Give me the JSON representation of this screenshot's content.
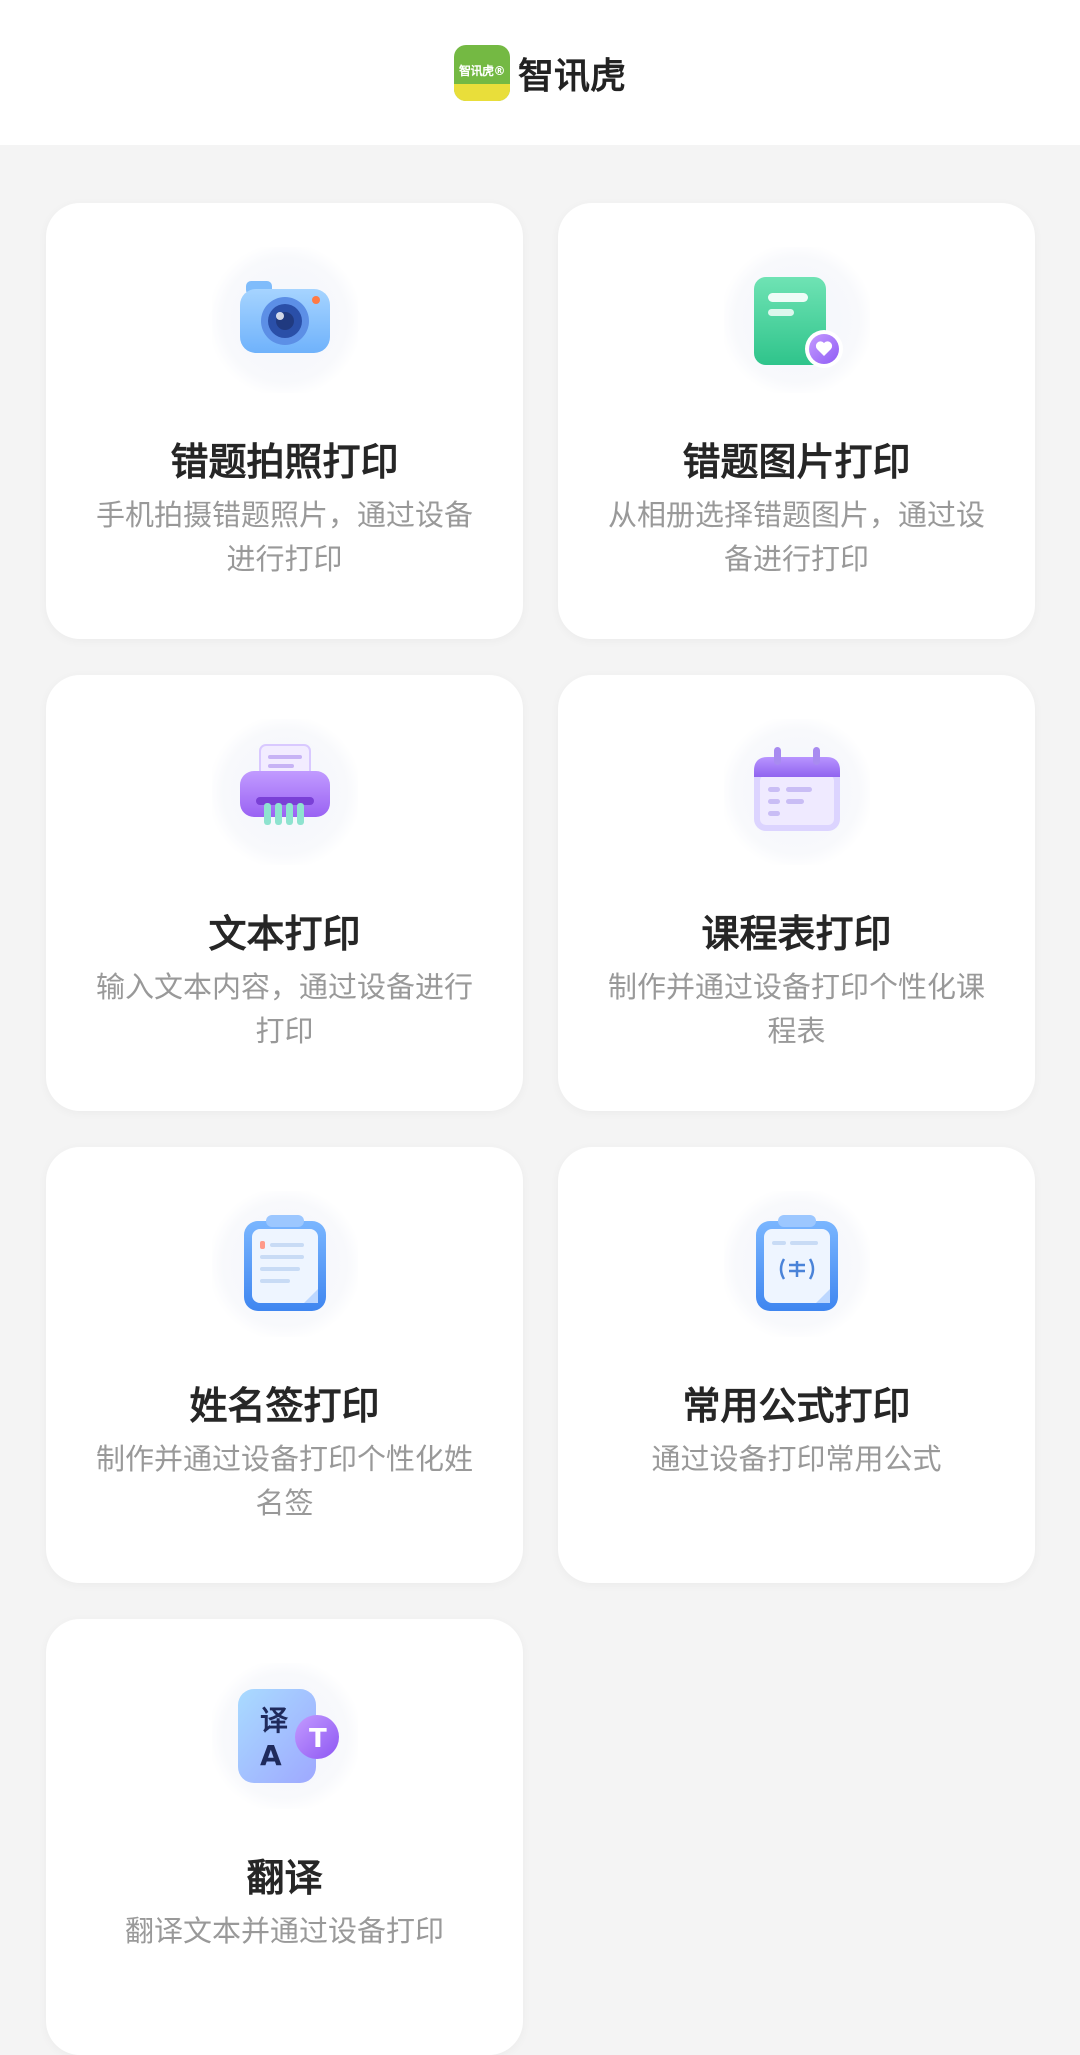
{
  "header": {
    "logo_text": "智讯虎®",
    "app_name": "智讯虎"
  },
  "cards": [
    {
      "title": "错题拍照打印",
      "desc": "手机拍摄错题照片，通过设备进行打印",
      "icon": "camera-icon"
    },
    {
      "title": "错题图片打印",
      "desc": "从相册选择错题图片，通过设备进行打印",
      "icon": "image-document-icon"
    },
    {
      "title": "文本打印",
      "desc": "输入文本内容，通过设备进行打印",
      "icon": "printer-icon"
    },
    {
      "title": "课程表打印",
      "desc": "制作并通过设备打印个性化课程表",
      "icon": "calendar-icon"
    },
    {
      "title": "姓名签打印",
      "desc": "制作并通过设备打印个性化姓名签",
      "icon": "clipboard-icon"
    },
    {
      "title": "常用公式打印",
      "desc": "通过设备打印常用公式",
      "icon": "formula-clipboard-icon"
    },
    {
      "title": "翻译",
      "desc": "翻译文本并通过设备打印",
      "icon": "translate-icon"
    }
  ],
  "icon_glyphs": {
    "translate_top": "译",
    "translate_bottom": "A",
    "translate_badge": "T"
  },
  "colors": {
    "background": "#f4f4f4",
    "card": "#ffffff",
    "title": "#262626",
    "description": "#999999",
    "logo_green": "#74b943",
    "logo_yellow": "#e9de3a"
  }
}
